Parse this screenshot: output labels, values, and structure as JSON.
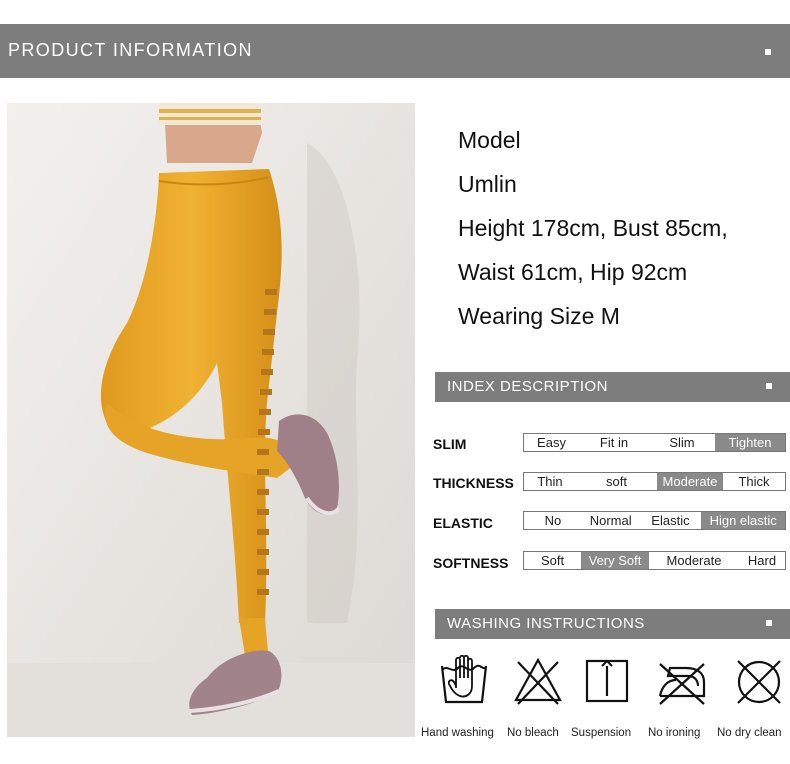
{
  "header": {
    "title": "PRODUCT  INFORMATION"
  },
  "model_info": {
    "line1": "Model",
    "line2": "Umlin",
    "line3": "Height 178cm,  Bust 85cm,",
    "line4": "Waist 61cm, Hip 92cm",
    "line5": "Wearing Size M"
  },
  "index_description": {
    "title": "INDEX DESCRIPTION",
    "rows": [
      {
        "label": "SLIM",
        "options": [
          "Easy",
          "Fit in",
          "Slim",
          "Tighten"
        ],
        "selected": "Tighten"
      },
      {
        "label": "THICKNESS",
        "options": [
          "Thin",
          "soft",
          "Moderate",
          "Thick"
        ],
        "selected": "Moderate"
      },
      {
        "label": "ELASTIC",
        "options": [
          "No",
          "Normal",
          "Elastic",
          "Hign elastic"
        ],
        "selected": "Hign elastic"
      },
      {
        "label": "SOFTNESS",
        "options": [
          "Soft",
          "Very Soft",
          "Moderate",
          "Hard"
        ],
        "selected": "Very Soft"
      }
    ]
  },
  "washing": {
    "title": "WASHING INSTRUCTIONS",
    "items": [
      {
        "label": "Hand washing",
        "icon": "hand-wash-icon"
      },
      {
        "label": "No bleach",
        "icon": "no-bleach-icon"
      },
      {
        "label": "Suspension",
        "icon": "line-dry-icon"
      },
      {
        "label": "No ironing",
        "icon": "no-iron-icon"
      },
      {
        "label": "No dry clean",
        "icon": "no-dry-clean-icon"
      }
    ]
  },
  "colors": {
    "bar": "#7d7d7d",
    "selected_cell": "#8a8a8a",
    "leggings": "#e8a52a"
  }
}
